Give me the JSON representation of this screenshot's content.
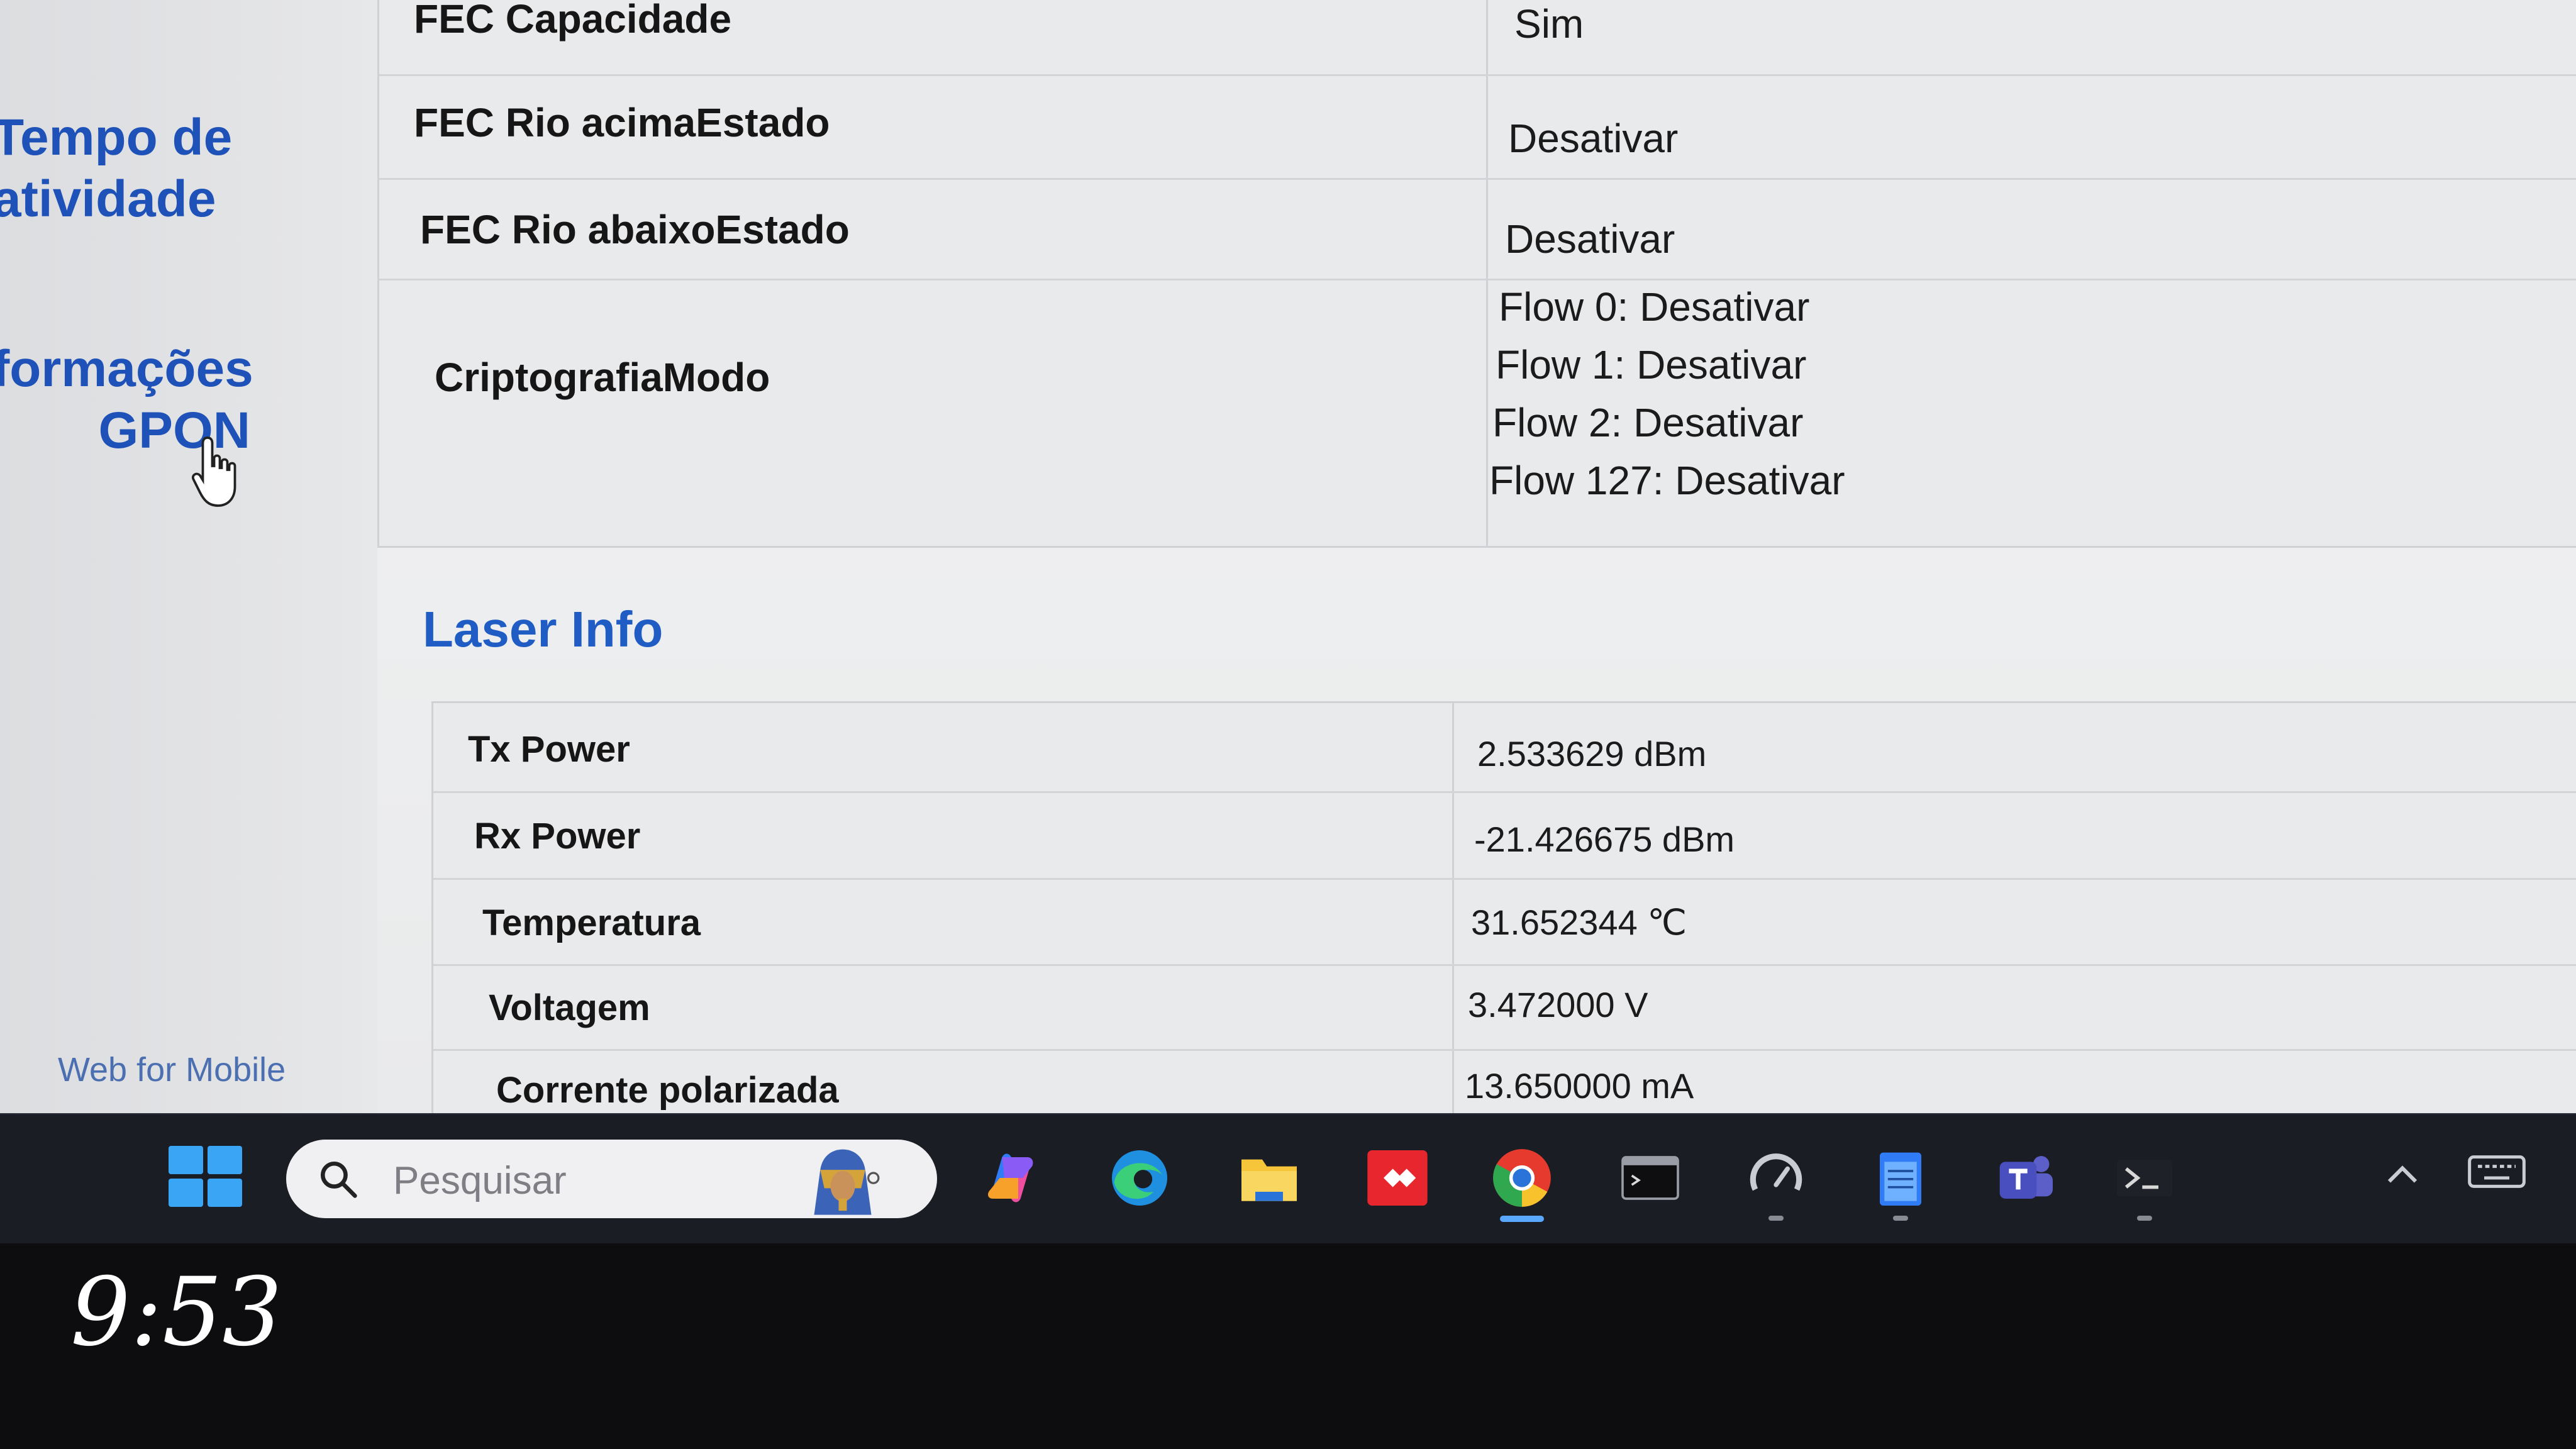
{
  "sidebar": {
    "link_uptime": "Tempo de\natividade",
    "link_gpon": "formações\nGPON",
    "footer_link": "Web for Mobile"
  },
  "upper_table": {
    "rows": [
      {
        "key": "FEC Capacidade",
        "value": "Sim"
      },
      {
        "key": "FEC Rio acimaEstado",
        "value": "Desativar"
      },
      {
        "key": "FEC Rio abaixoEstado",
        "value": "Desativar"
      },
      {
        "key": "CriptografiaModo",
        "values": [
          "Flow 0: Desativar",
          "Flow 1: Desativar",
          "Flow 2: Desativar",
          "Flow 127: Desativar"
        ]
      }
    ]
  },
  "laser_info": {
    "title": "Laser Info",
    "rows": [
      {
        "key": "Tx Power",
        "value": "2.533629 dBm"
      },
      {
        "key": "Rx Power",
        "value": "-21.426675 dBm"
      },
      {
        "key": "Temperatura",
        "value": "31.652344 ℃"
      },
      {
        "key": "Voltagem",
        "value": "3.472000 V"
      },
      {
        "key": "Corrente polarizada",
        "value": "13.650000 mA"
      }
    ]
  },
  "taskbar": {
    "search_placeholder": "Pesquisar",
    "icons": [
      "windows-start-icon",
      "copilot-icon",
      "edge-icon",
      "file-explorer-icon",
      "anydesk-icon",
      "chrome-icon",
      "terminal-window-icon",
      "speedometer-icon",
      "notepad-icon",
      "teams-icon",
      "powershell-icon"
    ],
    "clock": "9:53"
  },
  "colors": {
    "link_blue": "#1e52b8",
    "section_title_blue": "#1f5cc4",
    "taskbar_bg": "#1b1d24"
  }
}
